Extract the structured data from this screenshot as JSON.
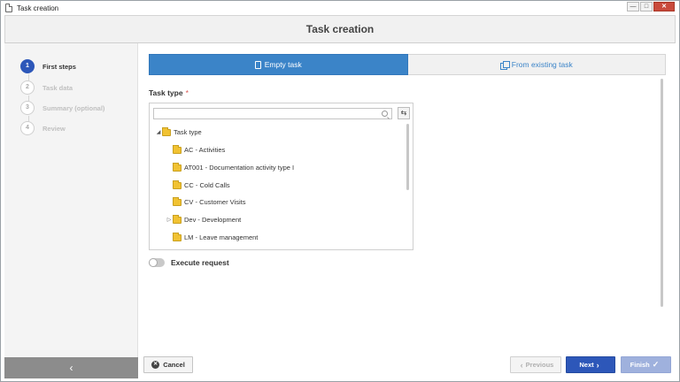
{
  "window": {
    "title": "Task creation",
    "minimize_glyph": "—",
    "maximize_glyph": "□",
    "close_glyph": "✕"
  },
  "header": {
    "title": "Task creation"
  },
  "steps": [
    {
      "num": "1",
      "label": "First steps",
      "active": true
    },
    {
      "num": "2",
      "label": "Task data",
      "active": false
    },
    {
      "num": "3",
      "label": "Summary (optional)",
      "active": false
    },
    {
      "num": "4",
      "label": "Review",
      "active": false
    }
  ],
  "sidebar": {
    "collapse_glyph": "‹"
  },
  "tabs": {
    "empty": "Empty task",
    "existing": "From existing task"
  },
  "task_type": {
    "label": "Task type",
    "required_mark": "*",
    "search_value": "",
    "tree_button_glyph": "⇆",
    "root": {
      "toggle": "◢",
      "label": "Task type"
    },
    "items": [
      {
        "label": "AC - Activities",
        "toggle": ""
      },
      {
        "label": "AT001 - Documentation activity type I",
        "toggle": ""
      },
      {
        "label": "CC - Cold Calls",
        "toggle": ""
      },
      {
        "label": "CV - Customer Visits",
        "toggle": ""
      },
      {
        "label": "Dev - Development",
        "toggle": "▷"
      },
      {
        "label": "LM - Leave management",
        "toggle": ""
      }
    ]
  },
  "execute_request": {
    "label": "Execute request",
    "on": false
  },
  "footer": {
    "cancel": "Cancel",
    "cancel_glyph": "✕",
    "previous": "Previous",
    "previous_glyph": "‹",
    "next": "Next",
    "next_glyph": "›",
    "finish": "Finish",
    "finish_glyph": "✓"
  },
  "colors": {
    "primary": "#2d57b9",
    "tab_active": "#3b84c8",
    "folder": "#f1c232",
    "required": "#d9534f"
  }
}
